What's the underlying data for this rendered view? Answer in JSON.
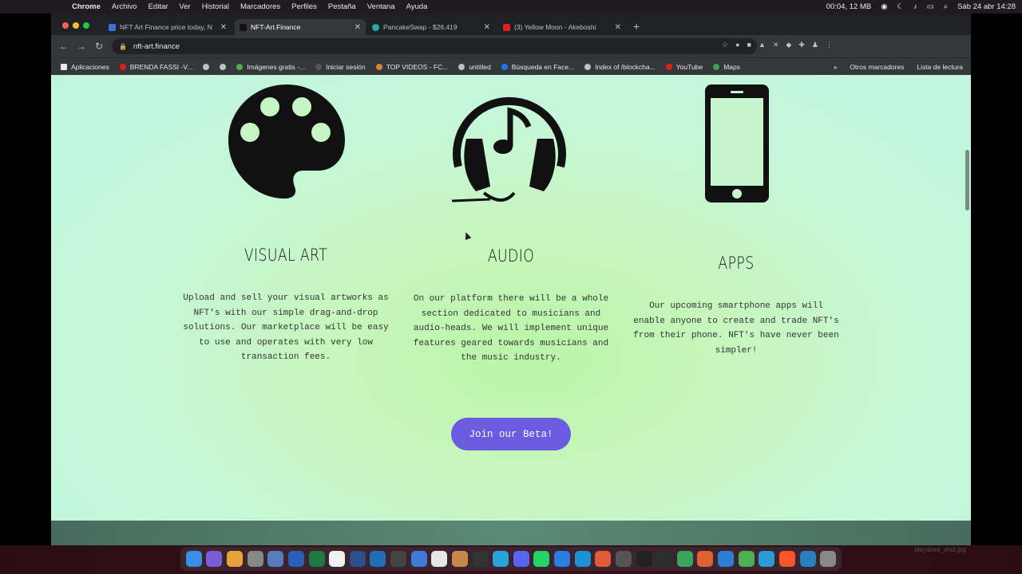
{
  "menubar": {
    "apple": "",
    "items": [
      "Chrome",
      "Archivo",
      "Editar",
      "Ver",
      "Historial",
      "Marcadores",
      "Perfiles",
      "Pestaña",
      "Ventana",
      "Ayuda"
    ],
    "status": "00:04, 12 MB",
    "clock": "Sáb 24 abr  14:28"
  },
  "tabs": [
    {
      "label": "NFT Art Finance price today, N",
      "color": "#3b6fe0"
    },
    {
      "label": "NFT-Art.Finance",
      "color": "#222222"
    },
    {
      "label": "PancakeSwap - $26,419",
      "color": "#2aa8a8"
    },
    {
      "label": "(3) Yellow Moon - Akeboshi",
      "color": "#e02020"
    }
  ],
  "omnibox": {
    "url": "nft-art.finance"
  },
  "bookmarks": [
    {
      "label": "Aplicaciones",
      "color": "#e8eaed"
    },
    {
      "label": "BRENDA FASSI -V...",
      "color": "#e02020"
    },
    {
      "label": "",
      "color": "#bdc1c6"
    },
    {
      "label": "",
      "color": "#bdc1c6"
    },
    {
      "label": "Imágenes gratis -...",
      "color": "#4caf50"
    },
    {
      "label": "Iniciar sesión",
      "color": "#333333"
    },
    {
      "label": "TOP VIDEOS - FC...",
      "color": "#d18a3a"
    },
    {
      "label": "untitled",
      "color": "#bdc1c6"
    },
    {
      "label": "Búsqueda en Face...",
      "color": "#1877f2"
    },
    {
      "label": "Index of /blockcha...",
      "color": "#bdc1c6"
    },
    {
      "label": "YouTube",
      "color": "#e02020"
    },
    {
      "label": "Maps",
      "color": "#34a853"
    }
  ],
  "bookmarks_right": [
    "»",
    "Otros marcadores",
    "Lista de lectura"
  ],
  "features": [
    {
      "title": "VISUAL ART",
      "text": "Upload and sell your visual artworks as\nNFT's with our simple drag-and-drop\nsolutions. Our marketplace will be easy\nto use and operates with very low\ntransaction fees.",
      "icon": "palette-icon"
    },
    {
      "title": "AUDIO",
      "text": "On our platform there will be a whole\nsection dedicated to musicians and\naudio-heads. We will implement unique\nfeatures geared towards musicians and\nthe music industry.",
      "icon": "headphones-icon"
    },
    {
      "title": "APPS",
      "text": "Our upcoming smartphone apps will\nenable anyone to create and trade NFT's\nfrom their phone. NFT's have never been\nsimpler!",
      "icon": "smartphone-icon"
    }
  ],
  "cta": {
    "label": "Join our Beta!",
    "color": "#6a5be0"
  },
  "watermark": "playstore_shot.jpg"
}
